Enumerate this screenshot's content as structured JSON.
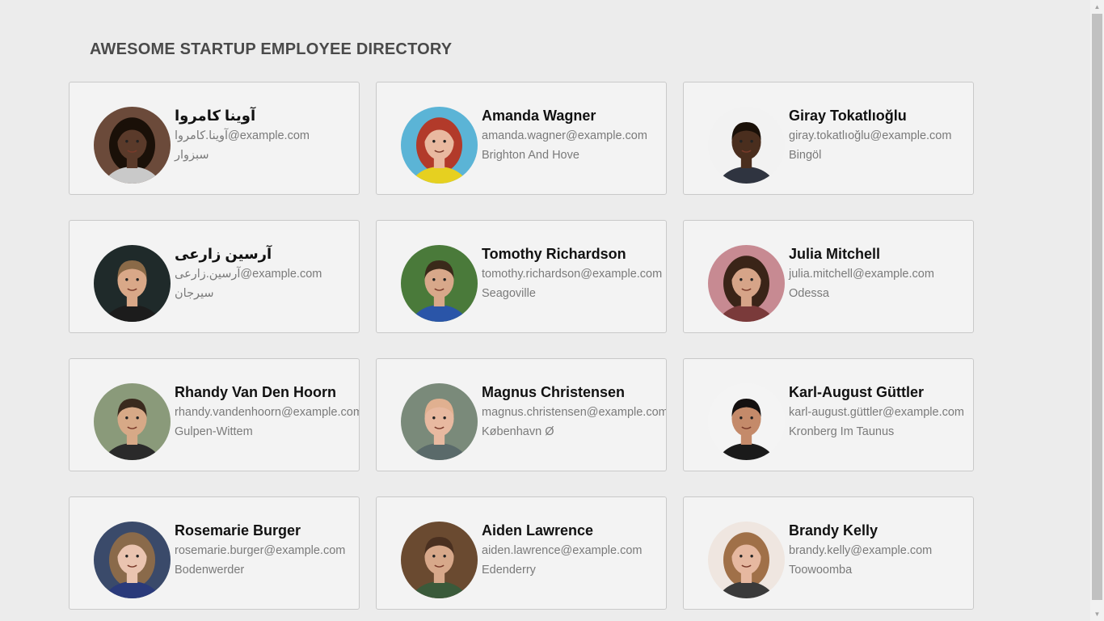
{
  "header": {
    "title": "AWESOME STARTUP EMPLOYEE DIRECTORY"
  },
  "employees": [
    {
      "name": "آوینا کامروا",
      "email": "آوینا.کامروا@example.com",
      "city": "سبزوار",
      "avatar": "woman-portrait-icon",
      "skin": "#5a3a2a",
      "hair": "#1a1008",
      "bg": "#6b4a3a",
      "shirt": "#c9c9c9"
    },
    {
      "name": "Amanda Wagner",
      "email": "amanda.wagner@example.com",
      "city": "Brighton And Hove",
      "avatar": "woman-portrait-icon",
      "skin": "#e9b9a0",
      "hair": "#b23a2a",
      "bg": "#5bb4d6",
      "shirt": "#e6d020"
    },
    {
      "name": "Giray Tokatlıoğlu",
      "email": "giray.tokatlıoğlu@example.com",
      "city": "Bingöl",
      "avatar": "man-portrait-icon",
      "skin": "#4a2e1e",
      "hair": "#1a1008",
      "bg": "#f2f2f2",
      "shirt": "#2f3440"
    },
    {
      "name": "آرسین زارعی",
      "email": "آرسین.زارعی@example.com",
      "city": "سیرجان",
      "avatar": "man-portrait-icon",
      "skin": "#d9a888",
      "hair": "#8a6a48",
      "bg": "#1f2a2a",
      "shirt": "#1c1c1c"
    },
    {
      "name": "Tomothy Richardson",
      "email": "tomothy.richardson@example.com",
      "city": "Seagoville",
      "avatar": "man-portrait-icon",
      "skin": "#d8a88a",
      "hair": "#3a2a1a",
      "bg": "#4a7a3a",
      "shirt": "#2a55a8"
    },
    {
      "name": "Julia Mitchell",
      "email": "julia.mitchell@example.com",
      "city": "Odessa",
      "avatar": "woman-portrait-icon",
      "skin": "#d6a488",
      "hair": "#3a2418",
      "bg": "#c78a92",
      "shirt": "#7a3a3a"
    },
    {
      "name": "Rhandy Van Den Hoorn",
      "email": "rhandy.vandenhoorn@example.com",
      "city": "Gulpen-Wittem",
      "avatar": "man-portrait-icon",
      "skin": "#d7a987",
      "hair": "#3a2a1e",
      "bg": "#8a9a7a",
      "shirt": "#2a2a2a"
    },
    {
      "name": "Magnus Christensen",
      "email": "magnus.christensen@example.com",
      "city": "København Ø",
      "avatar": "man-portrait-icon",
      "skin": "#e8b9a0",
      "hair": "#e0b090",
      "bg": "#7a8a7a",
      "shirt": "#5a6a6a"
    },
    {
      "name": "Karl-August Güttler",
      "email": "karl-august.güttler@example.com",
      "city": "Kronberg Im Taunus",
      "avatar": "man-portrait-icon",
      "skin": "#c48a6a",
      "hair": "#141010",
      "bg": "#f4f4f4",
      "shirt": "#1a1a1a"
    },
    {
      "name": "Rosemarie Burger",
      "email": "rosemarie.burger@example.com",
      "city": "Bodenwerder",
      "avatar": "woman-portrait-icon",
      "skin": "#eac4b0",
      "hair": "#8a6a4a",
      "bg": "#3a4a6a",
      "shirt": "#2a3a7a"
    },
    {
      "name": "Aiden Lawrence",
      "email": "aiden.lawrence@example.com",
      "city": "Edenderry",
      "avatar": "man-portrait-icon",
      "skin": "#d7a88a",
      "hair": "#4a3020",
      "bg": "#6a4a30",
      "shirt": "#3a5a3a"
    },
    {
      "name": "Brandy Kelly",
      "email": "brandy.kelly@example.com",
      "city": "Toowoomba",
      "avatar": "woman-portrait-icon",
      "skin": "#e6b8a0",
      "hair": "#a07048",
      "bg": "#efe6e0",
      "shirt": "#3a3a3a"
    }
  ]
}
